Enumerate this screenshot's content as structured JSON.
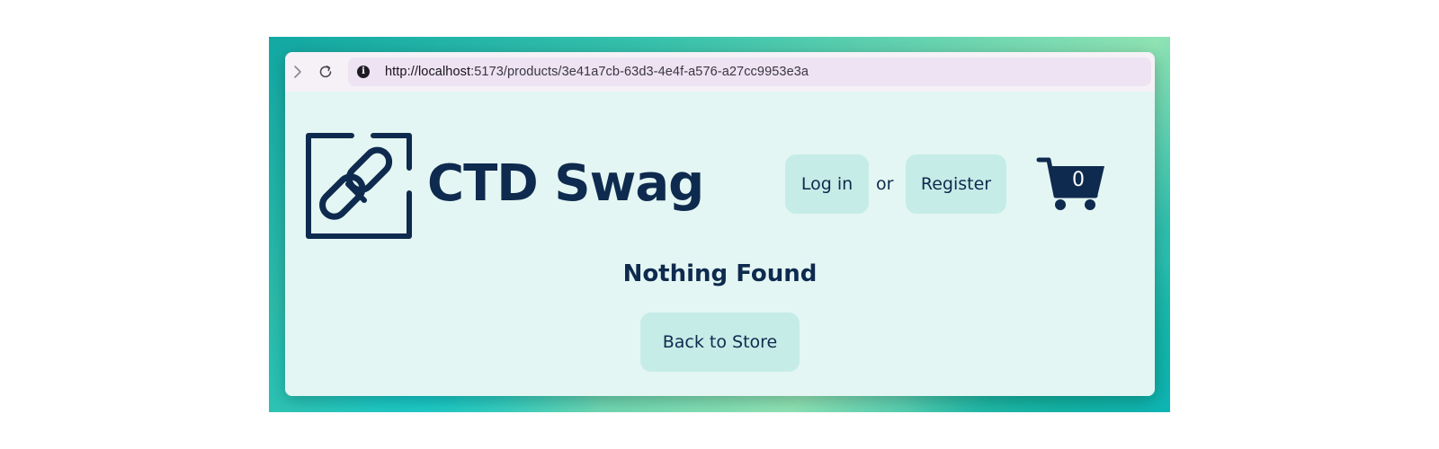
{
  "browser": {
    "url_host": "http://localhost",
    "url_rest": ":5173/products/3e41a7cb-63d3-4e4f-a576-a27cc9953e3a",
    "forward_icon": "chevron-right-icon",
    "reload_icon": "reload-icon",
    "site_info_icon": "info-icon"
  },
  "header": {
    "brand": "CTD Swag",
    "logo_icon": "link-logo-icon",
    "login_label": "Log in",
    "or_text": "or",
    "register_label": "Register",
    "cart_icon": "cart-icon",
    "cart_count": "0"
  },
  "main": {
    "heading": "Nothing Found",
    "back_label": "Back to Store"
  },
  "colors": {
    "navy": "#0e2a4e",
    "button_bg": "#c6ece7",
    "page_bg": "#e3f6f3",
    "urlbar_bg": "#ede3f2"
  }
}
